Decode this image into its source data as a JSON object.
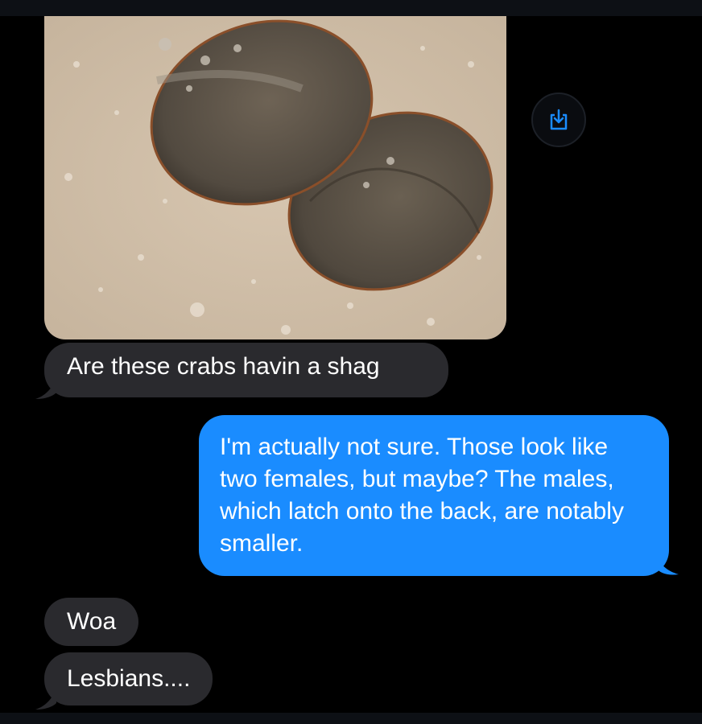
{
  "conversation": {
    "photo": {
      "icon": "horseshoe-crab-photo"
    },
    "save_button": {
      "icon": "save-to-device-icon",
      "color": "#1a8cff"
    },
    "messages": [
      {
        "direction": "incoming",
        "text": "Are these crabs havin a shag"
      },
      {
        "direction": "outgoing",
        "text": "I'm actually not sure. Those look like two females, but maybe? The males, which latch onto the back, are notably smaller."
      },
      {
        "direction": "incoming",
        "text": "Woa"
      },
      {
        "direction": "incoming",
        "text": "Lesbians...."
      }
    ]
  },
  "colors": {
    "background": "#000000",
    "incoming_bubble": "#2a2a2e",
    "outgoing_bubble": "#1a8cff",
    "text": "#ffffff"
  }
}
